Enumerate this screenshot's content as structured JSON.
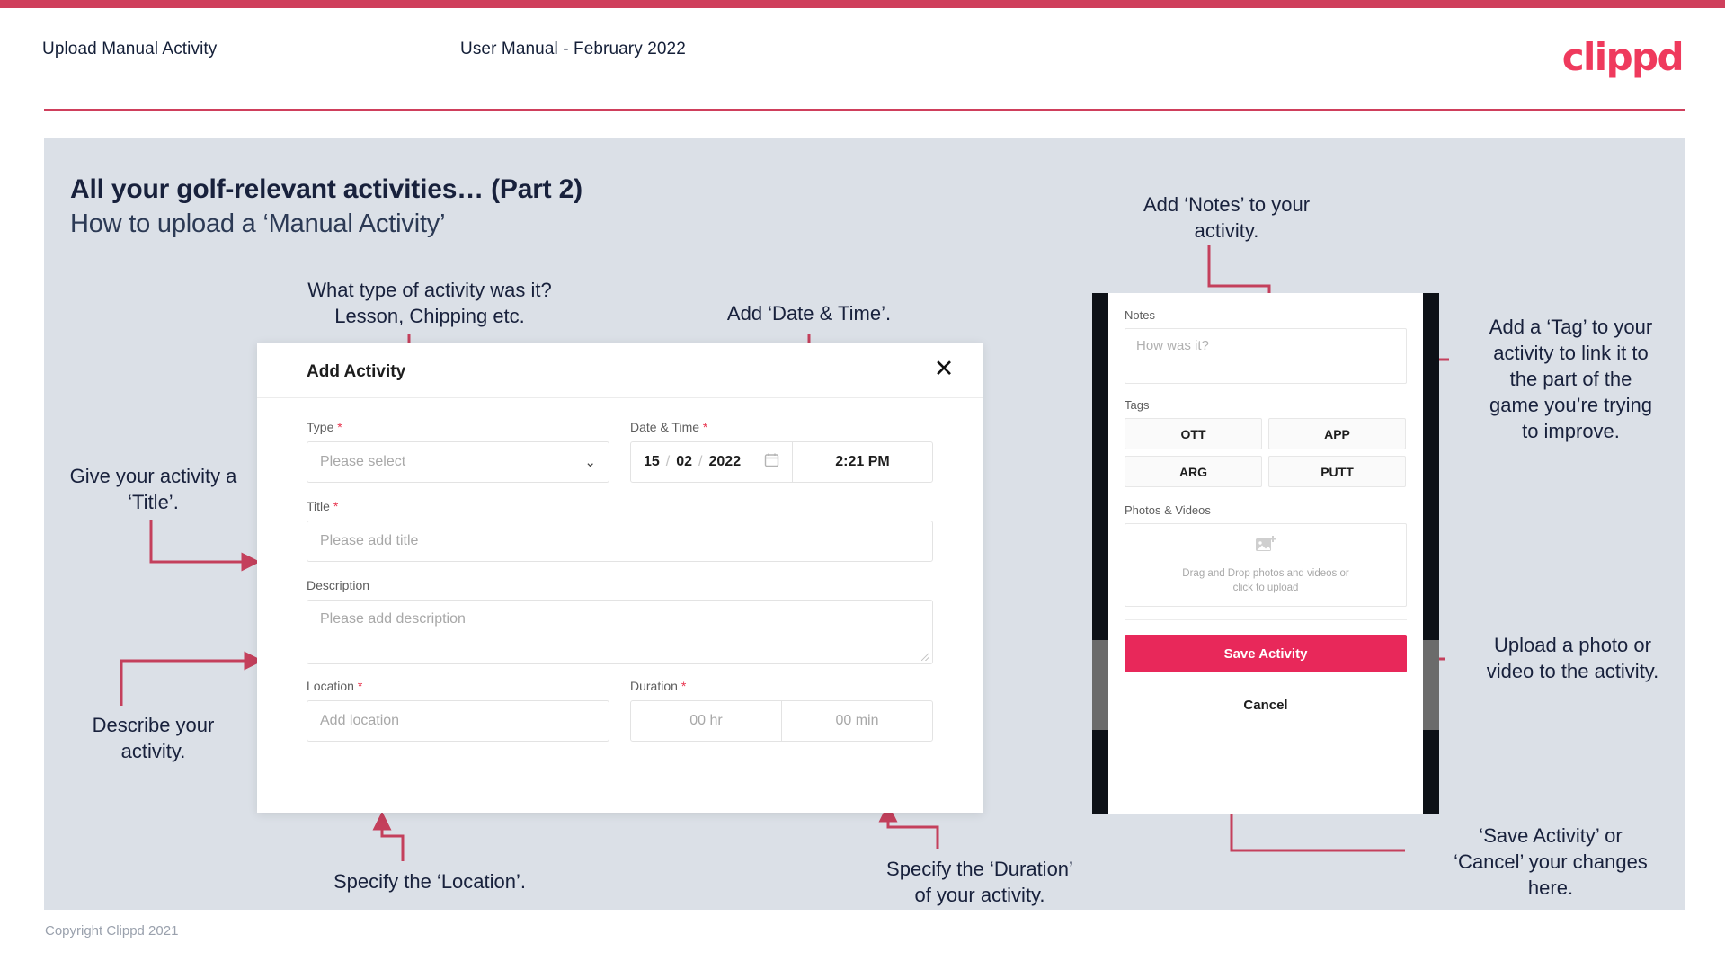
{
  "header": {
    "title": "Upload Manual Activity",
    "subtitle": "User Manual - February 2022",
    "logo": "clippd"
  },
  "slide": {
    "heading": "All your golf-relevant activities… (Part 2)",
    "subheading": "How to upload a ‘Manual Activity’",
    "footer": "Copyright Clippd 2021"
  },
  "colors": {
    "accent": "#cf3f5c",
    "brand": "#ef3a5d",
    "save_button": "#e8285a",
    "slide_bg": "#dbe0e7",
    "text": "#18213c",
    "arrow": "#c4405c"
  },
  "annotations": [
    {
      "id": "type-note",
      "text": "What type of activity was it?\nLesson, Chipping etc."
    },
    {
      "id": "datetime-note",
      "text": "Add ‘Date & Time’."
    },
    {
      "id": "title-note",
      "text": "Give your activity a\n‘Title’."
    },
    {
      "id": "describe-note",
      "text": "Describe your\nactivity."
    },
    {
      "id": "location-note",
      "text": "Specify the ‘Location’."
    },
    {
      "id": "duration-note",
      "text": "Specify the ‘Duration’\nof your activity."
    },
    {
      "id": "notes-note",
      "text": "Add ‘Notes’ to your\nactivity."
    },
    {
      "id": "tag-note",
      "text": "Add a ‘Tag’ to your\nactivity to link it to\nthe part of the\ngame you’re trying\nto improve."
    },
    {
      "id": "upload-note",
      "text": "Upload a photo or\nvideo to the activity."
    },
    {
      "id": "save-note",
      "text": "‘Save Activity’ or\n‘Cancel’ your changes\nhere."
    }
  ],
  "modal": {
    "title": "Add Activity",
    "close_icon": "✕",
    "fields": {
      "type": {
        "label": "Type",
        "required": "*",
        "value": "Please select",
        "chevron": "⌄"
      },
      "datetime": {
        "label": "Date & Time",
        "required": "*",
        "day": "15",
        "month": "02",
        "year": "2022",
        "sep": "/",
        "time": "2:21 PM"
      },
      "title": {
        "label": "Title",
        "required": "*",
        "placeholder": "Please add title"
      },
      "description": {
        "label": "Description",
        "placeholder": "Please add description"
      },
      "location": {
        "label": "Location",
        "required": "*",
        "placeholder": "Add location"
      },
      "duration": {
        "label": "Duration",
        "required": "*",
        "hours": "00 hr",
        "minutes": "00 min"
      }
    }
  },
  "phone": {
    "notes": {
      "label": "Notes",
      "placeholder": "How was it?"
    },
    "tags": {
      "label": "Tags",
      "items": [
        "OTT",
        "APP",
        "ARG",
        "PUTT"
      ]
    },
    "photos": {
      "label": "Photos & Videos",
      "dropzone_text": "Drag and Drop photos and videos or\nclick to upload"
    },
    "save_label": "Save Activity",
    "cancel_label": "Cancel"
  }
}
